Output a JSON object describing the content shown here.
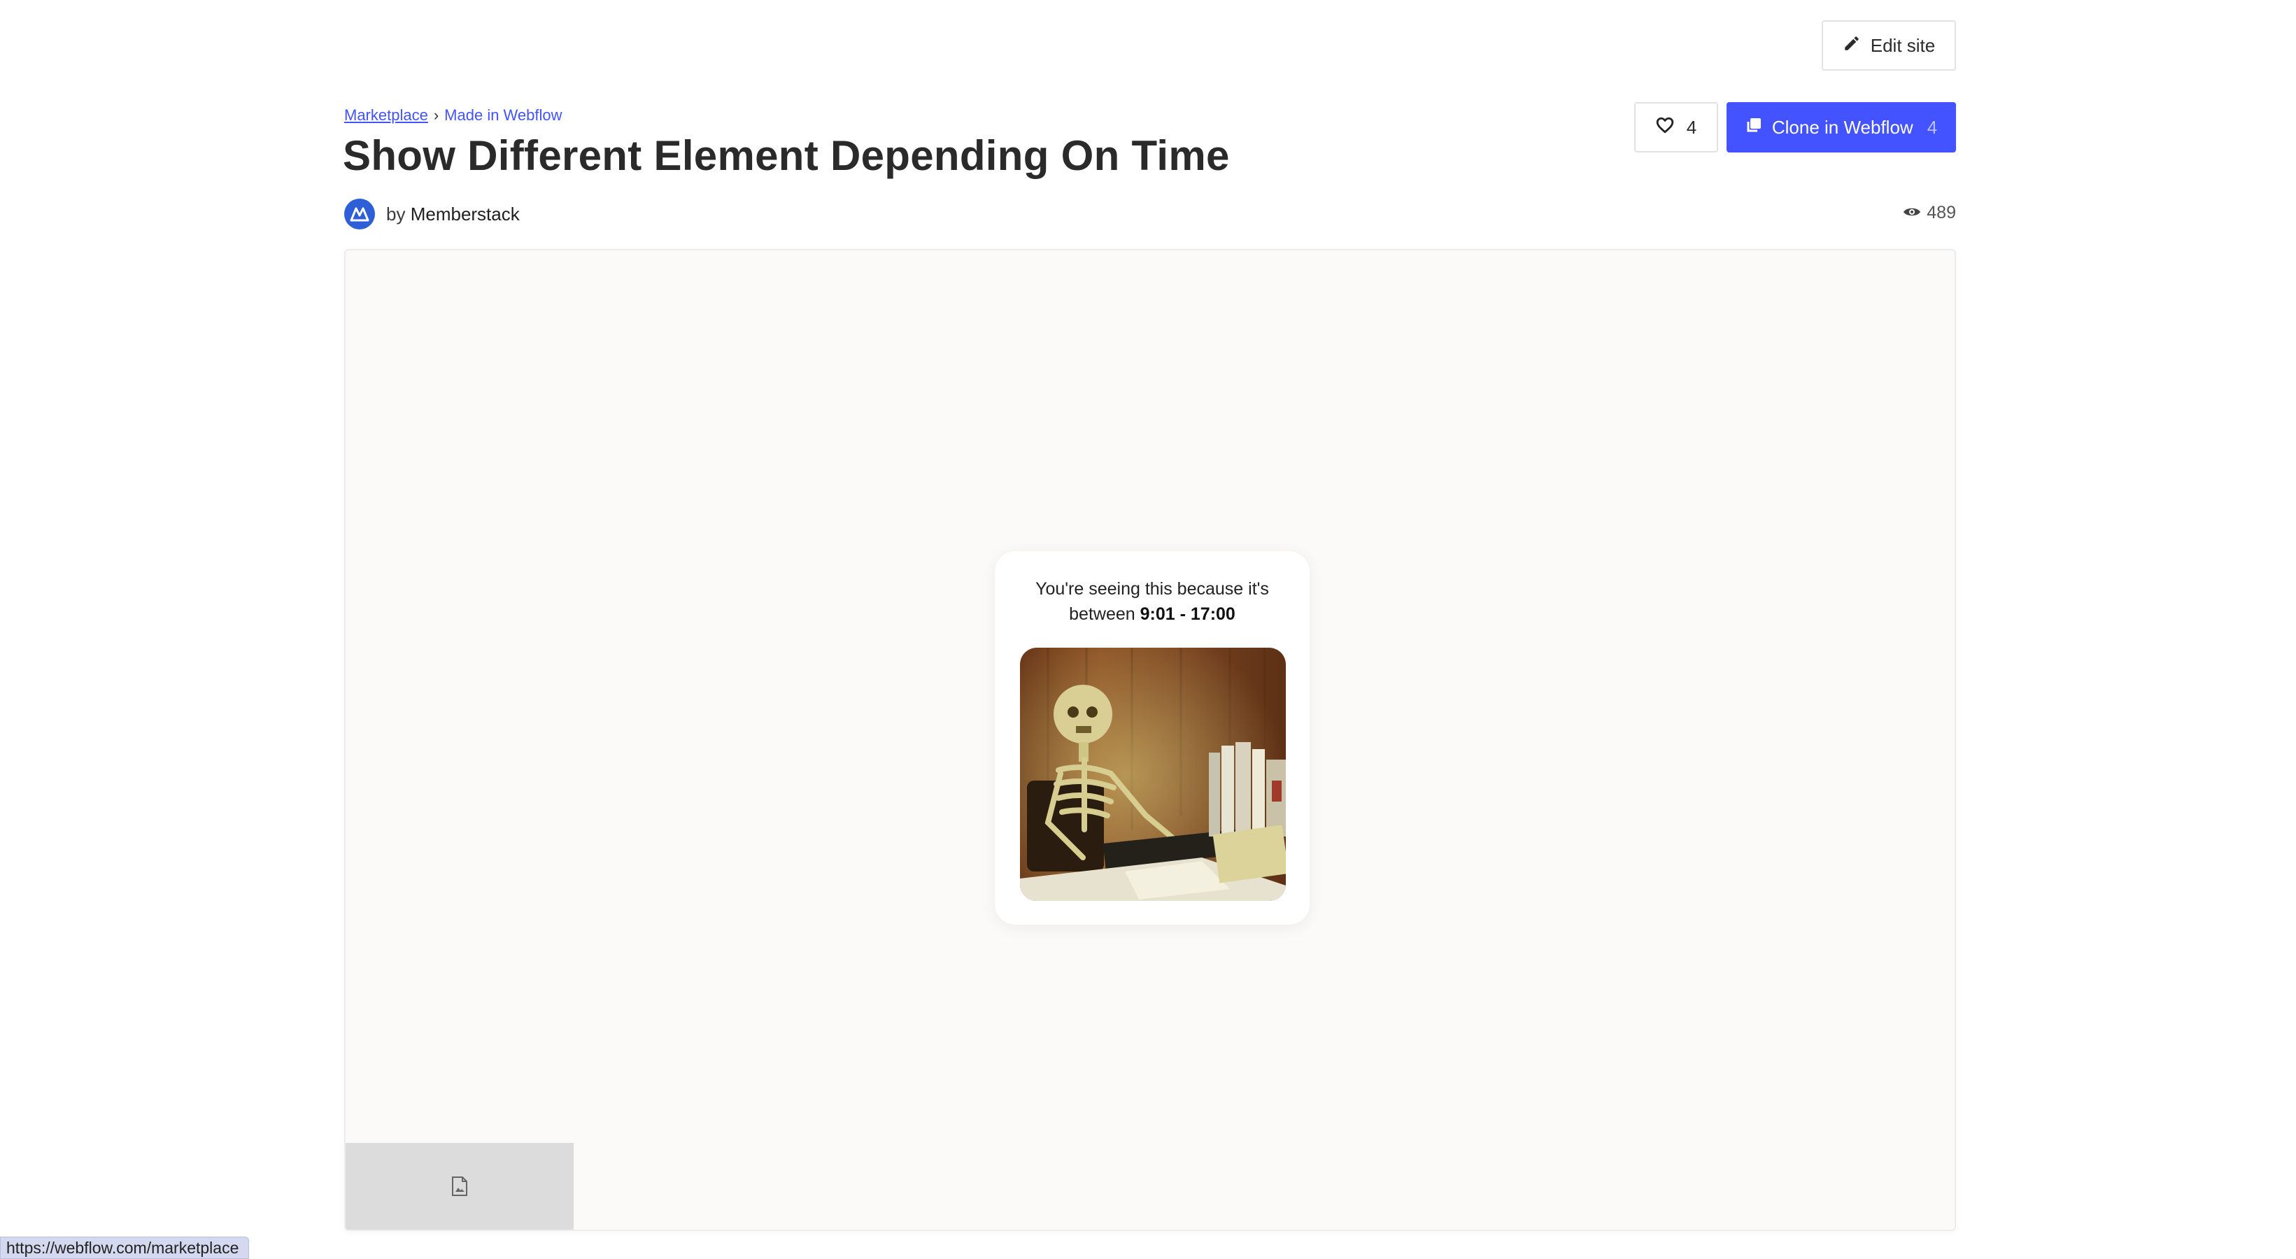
{
  "toolbar": {
    "edit_label": "Edit site"
  },
  "breadcrumb": {
    "root": "Marketplace",
    "separator": "›",
    "current": "Made in Webflow"
  },
  "page": {
    "title": "Show Different Element Depending On Time"
  },
  "author": {
    "prefix": "by",
    "name": "Memberstack"
  },
  "actions": {
    "like_count": "4",
    "clone_label": "Clone in Webflow",
    "clone_count": "4"
  },
  "stats": {
    "views": "489"
  },
  "preview_card": {
    "line1": "You're seeing this because it's",
    "line2_prefix": "between",
    "line2_time": "9:01 - 17:00"
  },
  "status_bar": {
    "url": "https://webflow.com/marketplace"
  },
  "colors": {
    "accent": "#4353ff",
    "avatar": "#2f5fd6",
    "preview_bg": "#fbfaf8"
  },
  "icons": [
    "pencil-icon",
    "heart-icon",
    "clone-icon",
    "eye-icon",
    "memberstack-logo-icon",
    "image-file-icon"
  ]
}
